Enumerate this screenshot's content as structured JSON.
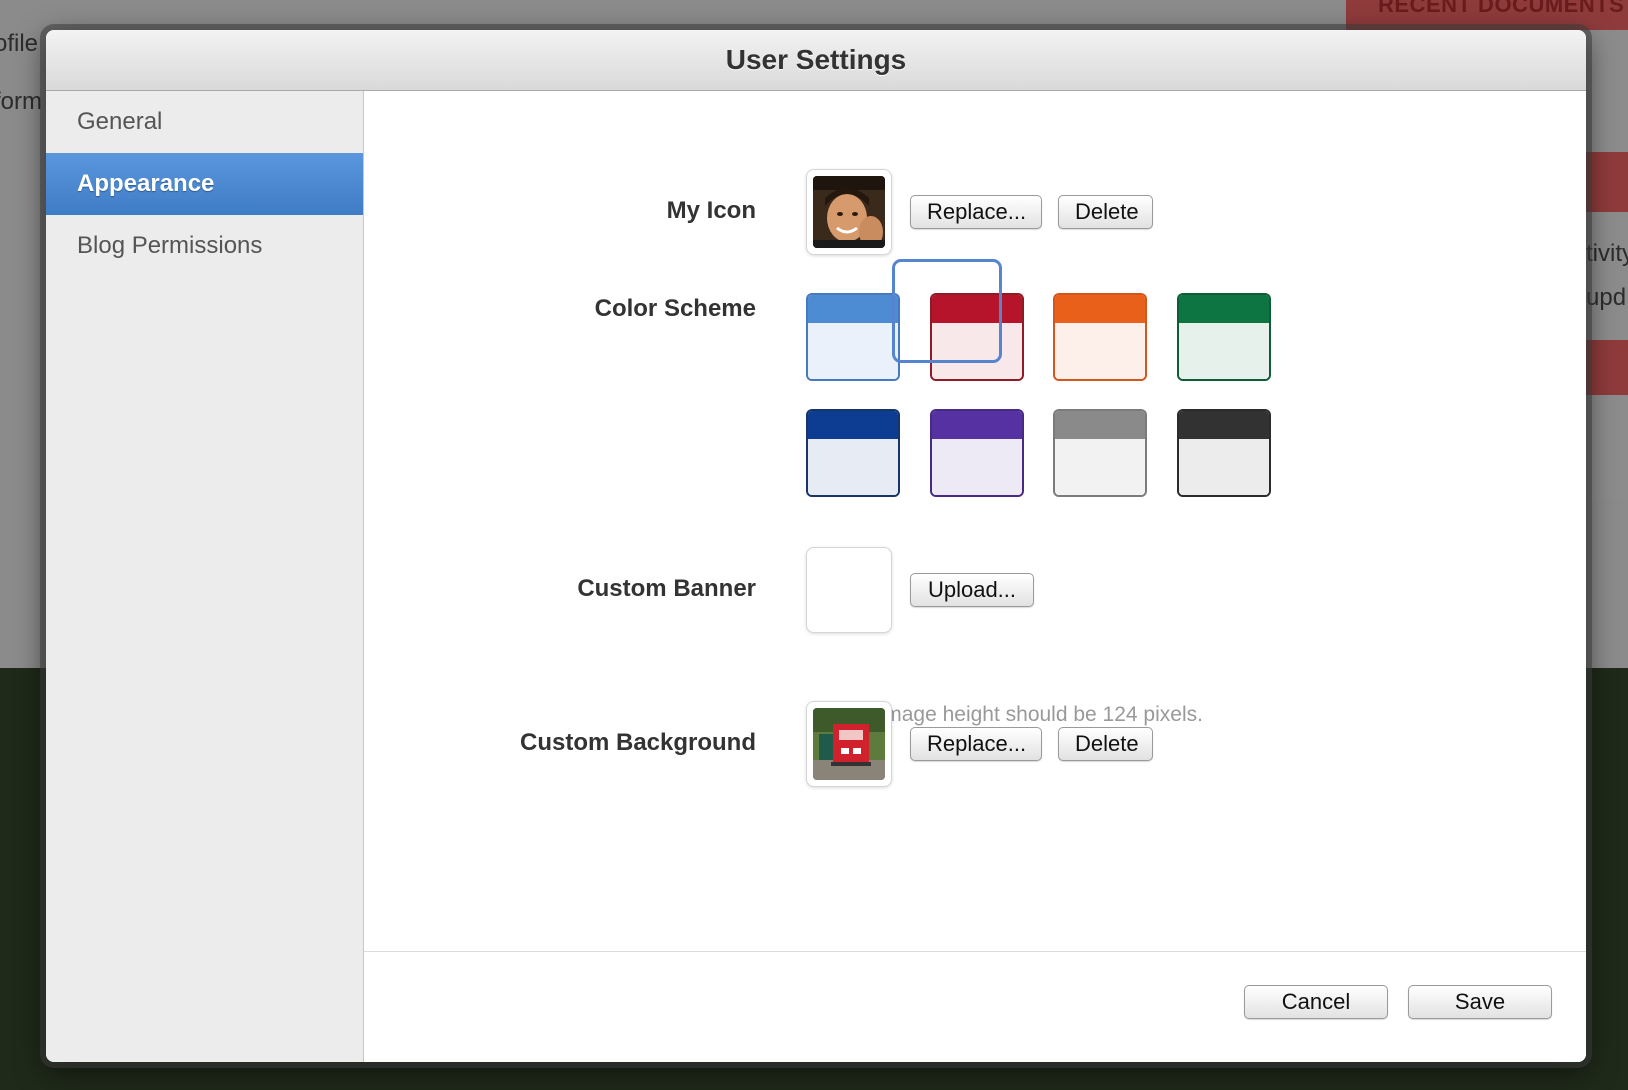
{
  "background": {
    "left_text": [
      "ofile",
      "form"
    ],
    "right_heading": "RECENT DOCUMENTS",
    "right_text": [
      "tivity",
      "upd"
    ]
  },
  "dialog": {
    "title": "User Settings",
    "sidebar": {
      "items": [
        {
          "label": "General",
          "active": false
        },
        {
          "label": "Appearance",
          "active": true
        },
        {
          "label": "Blog Permissions",
          "active": false
        }
      ]
    },
    "my_icon": {
      "label": "My Icon",
      "replace_label": "Replace...",
      "delete_label": "Delete"
    },
    "color_scheme": {
      "label": "Color Scheme",
      "selected": "red",
      "swatches": [
        {
          "name": "blue",
          "header": "#4d8bd3",
          "body": "#eaf1fa",
          "border": "#4679c0"
        },
        {
          "name": "red",
          "header": "#b5142a",
          "body": "#f8e8ea",
          "border": "#8e1b25"
        },
        {
          "name": "orange",
          "header": "#e9601a",
          "body": "#fdf0ea",
          "border": "#d3561a"
        },
        {
          "name": "green",
          "header": "#0d7542",
          "body": "#e7f1ec",
          "border": "#0d5d35"
        },
        {
          "name": "navy",
          "header": "#0c3d93",
          "body": "#e7ebf3",
          "border": "#183568"
        },
        {
          "name": "purple",
          "header": "#5531a1",
          "body": "#eeeaf5",
          "border": "#462a83"
        },
        {
          "name": "gray",
          "header": "#8a8a8a",
          "body": "#f2f2f2",
          "border": "#7b7b7b"
        },
        {
          "name": "black",
          "header": "#323232",
          "body": "#ececec",
          "border": "#2b2b2b"
        }
      ]
    },
    "custom_banner": {
      "label": "Custom Banner",
      "upload_label": "Upload...",
      "hint": "Banner image height should be 124 pixels."
    },
    "custom_background": {
      "label": "Custom Background",
      "replace_label": "Replace...",
      "delete_label": "Delete"
    },
    "footer": {
      "cancel_label": "Cancel",
      "save_label": "Save"
    }
  }
}
